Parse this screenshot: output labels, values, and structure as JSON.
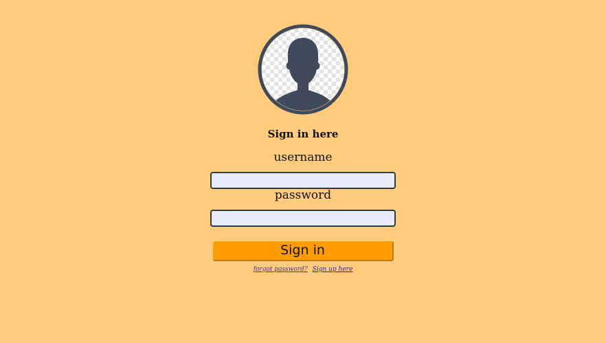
{
  "form": {
    "heading": "Sign in here",
    "username_label": "username",
    "username_value": "",
    "password_label": "password",
    "password_value": "",
    "signin_label": "Sign in",
    "forgot_link": "forgot password?",
    "signup_link": "Sign up here"
  },
  "colors": {
    "background": "#ffcb7d",
    "button": "#fe9c00",
    "input_bg": "#e8ecfa",
    "avatar": "#414a5a"
  },
  "icons": {
    "avatar": "user-silhouette-icon"
  }
}
